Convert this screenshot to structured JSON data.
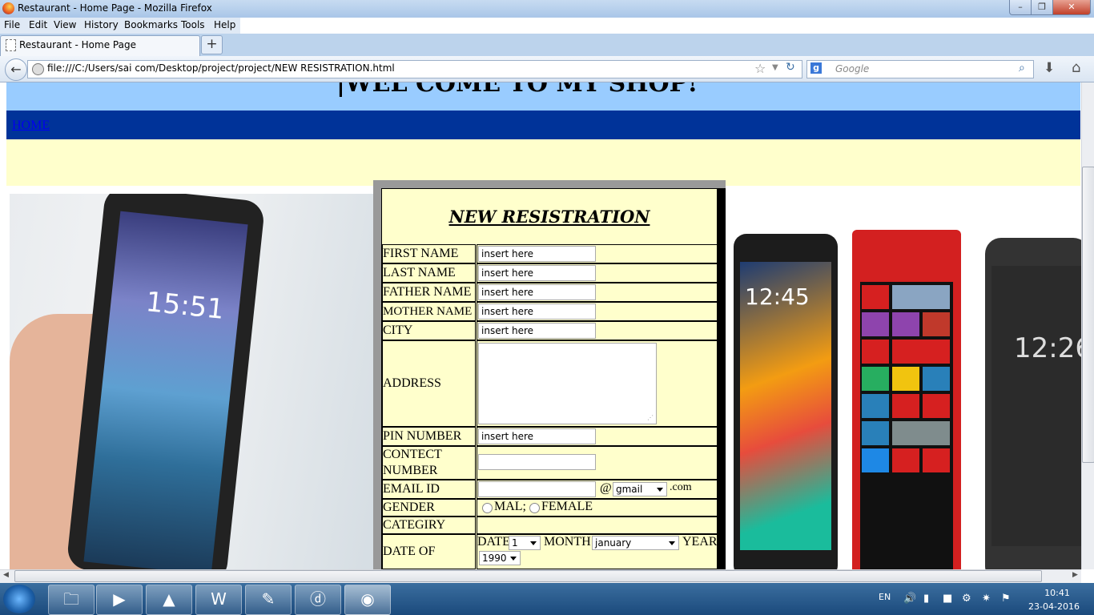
{
  "window": {
    "title": "Restaurant - Home Page - Mozilla Firefox",
    "minimize": "–",
    "maximize": "❐",
    "close": "✕"
  },
  "menu": [
    "File",
    "Edit",
    "View",
    "History",
    "Bookmarks",
    "Tools",
    "Help"
  ],
  "tab": {
    "label": "Restaurant - Home Page",
    "new_tab": "+"
  },
  "navbar": {
    "url": "file:///C:/Users/sai com/Desktop/project/project/NEW RESISTRATION.html",
    "search_placeholder": "Google",
    "search_engine_glyph": "g"
  },
  "page": {
    "header_text": "|WEL COME TO MY SHOP!",
    "nav_link": "HOME",
    "left_phone_time": "15:51",
    "right_phone1_time": "12:45",
    "right_phone3_time": "12:26"
  },
  "form": {
    "title": "NEW RESISTRATION",
    "fields": [
      {
        "label": "FIRST NAME",
        "value": "insert here"
      },
      {
        "label": "LAST NAME",
        "value": "insert here"
      },
      {
        "label": "FATHER NAME",
        "value": "insert here"
      },
      {
        "label": "MOTHER NAME",
        "value": "insert here"
      },
      {
        "label": "CITY",
        "value": "insert here"
      }
    ],
    "address_label": "ADDRESS",
    "pin_label": "PIN NUMBER",
    "pin_value": "insert here",
    "contact_label": "CONTECT NUMBER",
    "contact_value": "",
    "email_label": "EMAIL ID",
    "email_value": "",
    "email_at": "@",
    "email_domain": "gmail",
    "email_suffix": ".com",
    "gender_label": "GENDER",
    "gender_options": [
      "MAL;",
      "FEMALE"
    ],
    "category_label": "CATEGIRY",
    "dob_label": "DATE OF BRITH",
    "dob_date_label": "DATE",
    "dob_date_value": "1",
    "dob_month_label": "MONTH",
    "dob_month_value": "january",
    "dob_year_label": "YEAR",
    "dob_year_value": "1990"
  },
  "taskbar": {
    "language": "EN",
    "time": "10:41",
    "date": "23-04-2016"
  }
}
